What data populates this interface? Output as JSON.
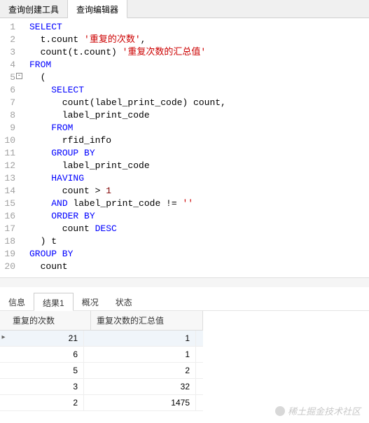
{
  "top_tabs": {
    "builder": "查询创建工具",
    "editor": "查询编辑器"
  },
  "code": {
    "lines": [
      {
        "n": 1,
        "raw": "SELECT"
      },
      {
        "n": 2,
        "raw": "  t.count '重复的次数',"
      },
      {
        "n": 3,
        "raw": "  count(t.count) '重复次数的汇总值'"
      },
      {
        "n": 4,
        "raw": "FROM"
      },
      {
        "n": 5,
        "raw": "  ("
      },
      {
        "n": 6,
        "raw": "    SELECT"
      },
      {
        "n": 7,
        "raw": "      count(label_print_code) count,"
      },
      {
        "n": 8,
        "raw": "      label_print_code"
      },
      {
        "n": 9,
        "raw": "    FROM"
      },
      {
        "n": 10,
        "raw": "      rfid_info"
      },
      {
        "n": 11,
        "raw": "    GROUP BY"
      },
      {
        "n": 12,
        "raw": "      label_print_code"
      },
      {
        "n": 13,
        "raw": "    HAVING"
      },
      {
        "n": 14,
        "raw": "      count > 1"
      },
      {
        "n": 15,
        "raw": "    AND label_print_code != ''"
      },
      {
        "n": 16,
        "raw": "    ORDER BY"
      },
      {
        "n": 17,
        "raw": "      count DESC"
      },
      {
        "n": 18,
        "raw": "  ) t"
      },
      {
        "n": 19,
        "raw": "GROUP BY"
      },
      {
        "n": 20,
        "raw": "  count"
      }
    ]
  },
  "bottom_tabs": {
    "info": "信息",
    "result1": "结果1",
    "overview": "概况",
    "status": "状态"
  },
  "grid": {
    "headers": {
      "col_a": "重复的次数",
      "col_b": "重复次数的汇总值"
    },
    "rows": [
      {
        "a": "21",
        "b": "1"
      },
      {
        "a": "6",
        "b": "1"
      },
      {
        "a": "5",
        "b": "2"
      },
      {
        "a": "3",
        "b": "32"
      },
      {
        "a": "2",
        "b": "1475"
      }
    ]
  },
  "watermark": "稀土掘金技术社区"
}
